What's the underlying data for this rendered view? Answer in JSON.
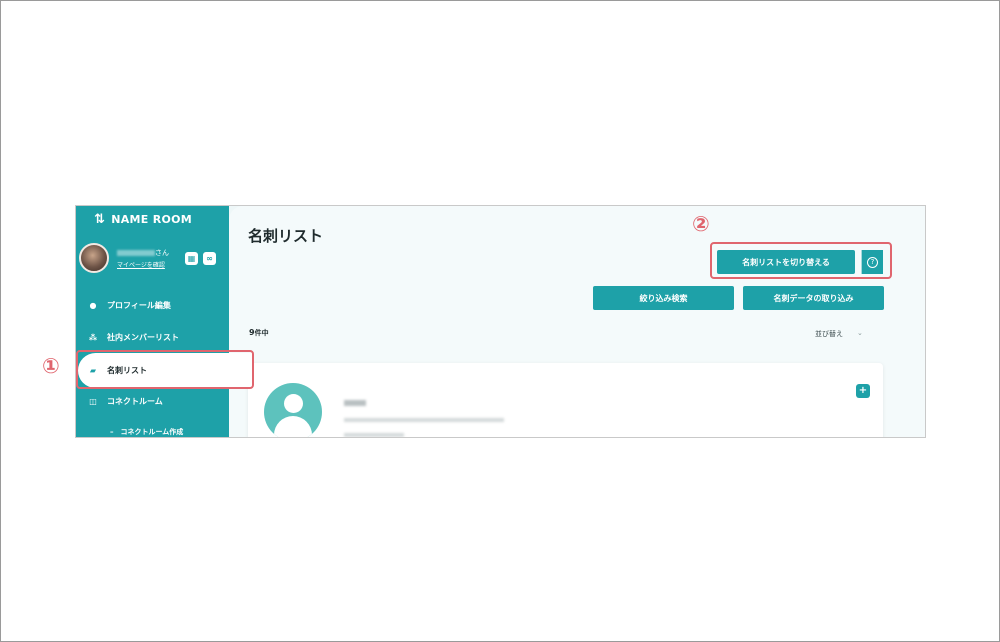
{
  "app": {
    "logo_text": "NAME ROOM",
    "logo_mark": "⇅"
  },
  "profile": {
    "name_suffix": "さん",
    "mypage_link": "マイページを確認",
    "qr_icon": "qr-icon",
    "link_icon": "link-icon"
  },
  "sidebar": {
    "items": [
      {
        "label": "プロフィール編集",
        "icon": "person-icon"
      },
      {
        "label": "社内メンバーリスト",
        "icon": "group-icon"
      },
      {
        "label": "名刺リスト",
        "icon": "card-stack-icon"
      },
      {
        "label": "コネクトルーム",
        "icon": "room-icon"
      }
    ],
    "sub_items": [
      {
        "label": "–　コネクトルーム作成"
      }
    ]
  },
  "main": {
    "title": "名刺リスト",
    "switch_button": "名刺リストを切り替える",
    "help_symbol": "?",
    "filter_button": "絞り込み検索",
    "import_button": "名刺データの取り込み",
    "count_number": "9",
    "count_unit": "件中",
    "sort_label": "並び替え",
    "sort_chevron": "⌄"
  },
  "card": {
    "add_symbol": "+"
  },
  "annotations": {
    "marker_1": "①",
    "marker_2": "②",
    "color": "#e0656e"
  },
  "colors": {
    "accent": "#1ea1a8",
    "annotation": "#e0656e"
  }
}
